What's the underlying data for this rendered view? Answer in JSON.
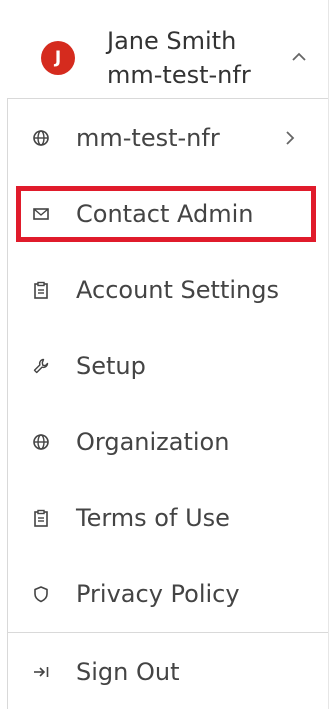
{
  "user": {
    "avatar_initial": "J",
    "name": "Jane Smith",
    "org": "mm-test-nfr",
    "avatar_color": "#d52b1e"
  },
  "menu": [
    {
      "label": "mm-test-nfr",
      "icon": "globe-icon",
      "has_submenu": true
    },
    {
      "label": "Contact Admin",
      "icon": "mail-icon",
      "highlighted": true
    },
    {
      "label": "Account Settings",
      "icon": "clipboard-icon"
    },
    {
      "label": "Setup",
      "icon": "wrench-icon"
    },
    {
      "label": "Organization",
      "icon": "globe-icon"
    },
    {
      "label": "Terms of Use",
      "icon": "clipboard-icon"
    },
    {
      "label": "Privacy Policy",
      "icon": "shield-icon"
    }
  ],
  "sign_out": {
    "label": "Sign Out",
    "icon": "sign-out-icon"
  },
  "colors": {
    "highlight_border": "#e01b2b",
    "text": "#444444"
  }
}
